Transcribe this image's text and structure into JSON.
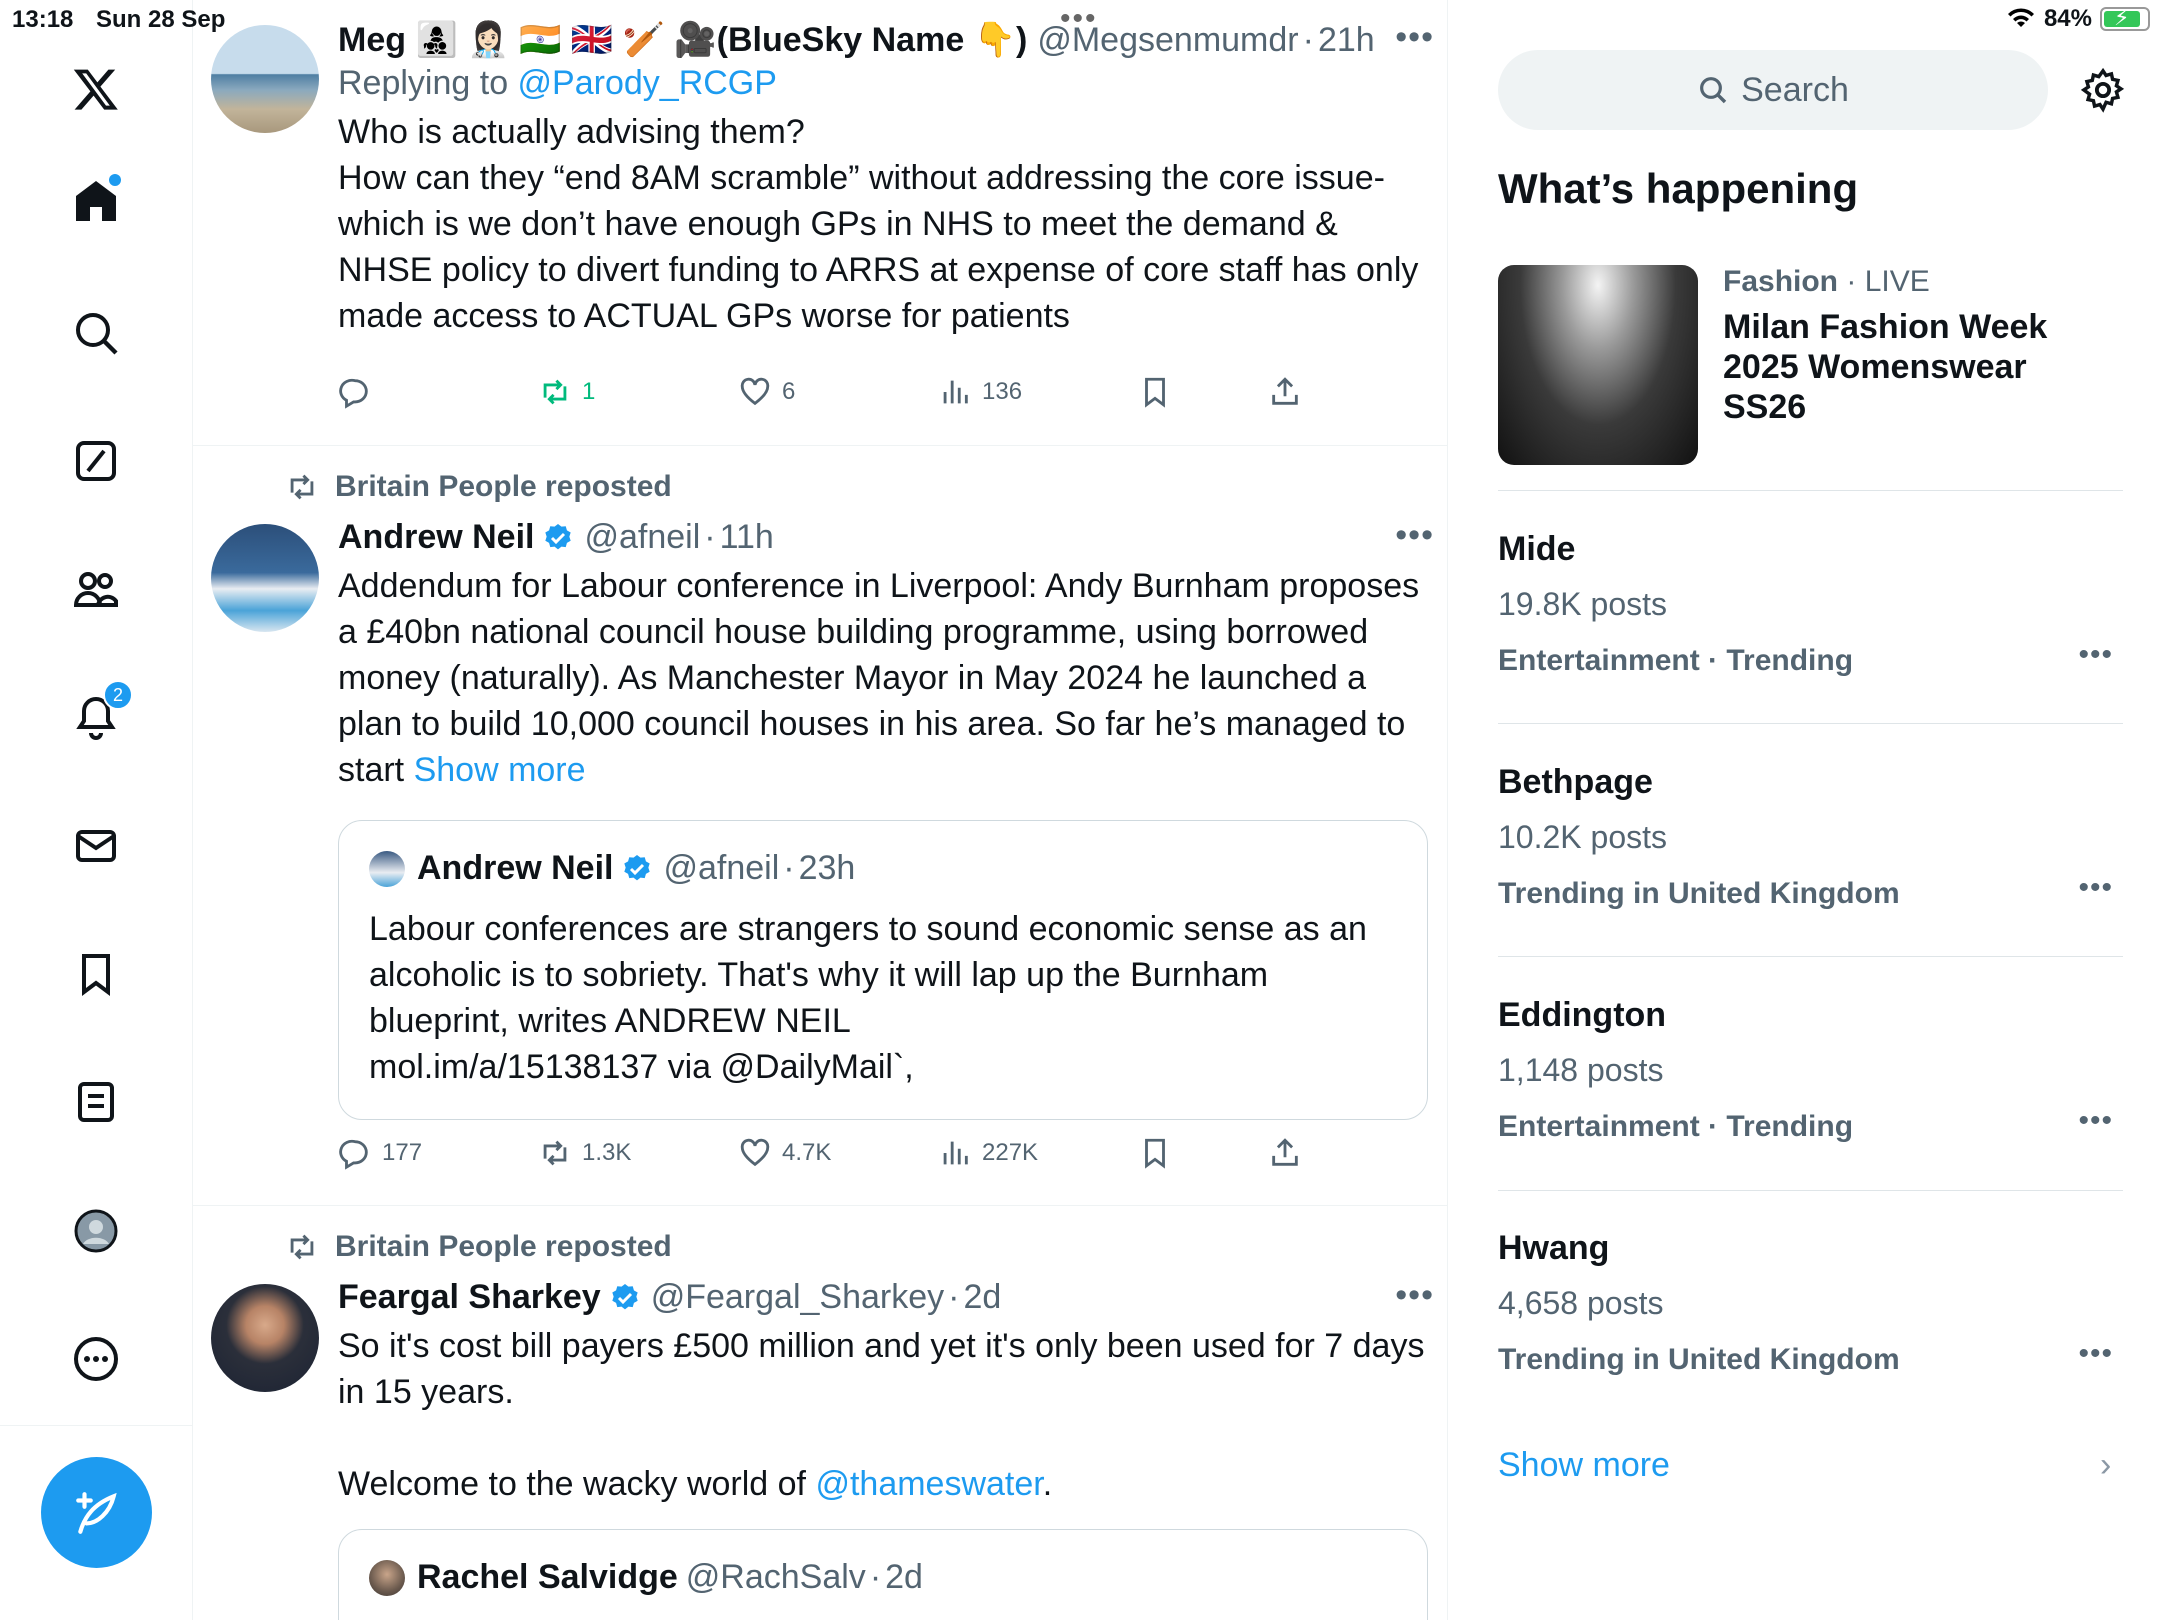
{
  "status_bar": {
    "time": "13:18",
    "date": "Sun 28 Sep",
    "battery": "84%"
  },
  "nav": {
    "notifications_badge": "2",
    "icons": [
      "x-logo-icon",
      "home-icon",
      "search-icon",
      "grok-icon",
      "communities-icon",
      "notifications-icon",
      "messages-icon",
      "bookmarks-icon",
      "lists-icon",
      "profile-icon",
      "more-icon",
      "compose-icon"
    ]
  },
  "feed": {
    "tweets": [
      {
        "display_name": "Meg 👩‍👧‍👦 👩🏻‍⚕️ 🇮🇳 🇬🇧 🏏 🎥(BlueSky Name 👇)",
        "handle": "@Megsenmumdr",
        "sep": "·",
        "time": "21h",
        "reply_prefix": "Replying to ",
        "reply_to": "@Parody_RCGP",
        "text": "Who is actually advising them?\nHow can they “end 8AM scramble” without addressing the core issue- which is we don’t have enough GPs in NHS to meet the demand & NHSE policy to divert funding to ARRS at expense of core staff has only made access to ACTUAL GPs worse for patients",
        "replies": "",
        "reposts": "1",
        "likes": "6",
        "views": "136"
      },
      {
        "reposted_by": "Britain People reposted",
        "display_name": "Andrew Neil",
        "handle": "@afneil",
        "sep": "·",
        "time": "11h",
        "text": "Addendum for Labour conference in Liverpool: Andy Burnham proposes a £40bn national council house building programme, using borrowed money (naturally). As Manchester Mayor in May 2024 he launched a  plan to build 10,000 council houses in his area. So far he’s managed to start ",
        "show_more": "Show more",
        "quote": {
          "display_name": "Andrew Neil",
          "handle": "@afneil",
          "sep": "·",
          "time": "23h",
          "text": "Labour conferences are strangers to sound economic sense as an alcoholic is to sobriety. That's why it will lap up the Burnham blueprint, writes ANDREW NEIL\nmol.im/a/15138137 via @DailyMail`,"
        },
        "replies": "177",
        "reposts": "1.3K",
        "likes": "4.7K",
        "views": "227K"
      },
      {
        "reposted_by": "Britain People reposted",
        "display_name": "Feargal Sharkey",
        "handle": "@Feargal_Sharkey",
        "sep": "·",
        "time": "2d",
        "text": "So it's cost bill payers £500 million and yet it's only been used for 7 days in 15 years.",
        "text2_prefix": "Welcome to the wacky world of ",
        "text2_link": "@thameswater",
        "text2_suffix": ".",
        "quote": {
          "display_name": "Rachel Salvidge",
          "handle": "@RachSalv",
          "sep": "·",
          "time": "2d"
        }
      }
    ]
  },
  "sidebar": {
    "search_placeholder": "Search",
    "section_title": "What’s happening",
    "featured": {
      "category": "Fashion",
      "sep": " · ",
      "status": "LIVE",
      "title": "Milan Fashion Week 2025 Womenswear SS26"
    },
    "trends": [
      {
        "name": "Mide",
        "count": "19.8K posts",
        "context": "Entertainment · Trending"
      },
      {
        "name": "Bethpage",
        "count": "10.2K posts",
        "context": "Trending in United Kingdom"
      },
      {
        "name": "Eddington",
        "count": "1,148 posts",
        "context": "Entertainment · Trending"
      },
      {
        "name": "Hwang",
        "count": "4,658 posts",
        "context": "Trending in United Kingdom"
      }
    ],
    "show_more": "Show more"
  },
  "colors": {
    "accent": "#1d9bf0",
    "secondary_text": "#536471",
    "repost_active": "#00ba7c"
  }
}
